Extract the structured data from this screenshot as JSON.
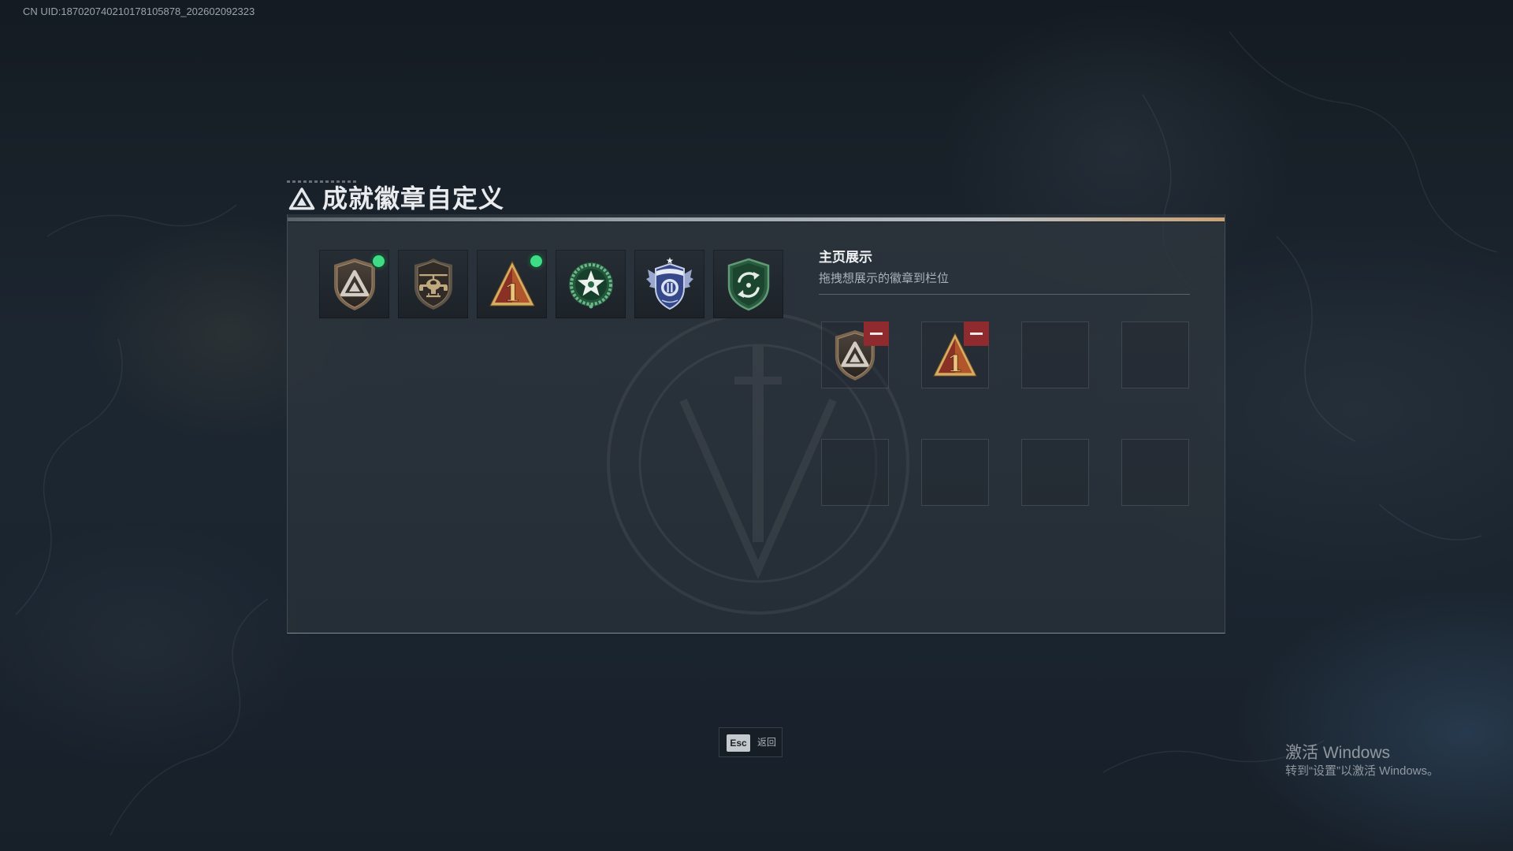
{
  "uid": "CN UID:187020740210178105878_202602092323",
  "title": "成就徽章自定义",
  "colors": {
    "new_dot": "#3fdc86",
    "remove_button": "#8f2b2f",
    "panel_accent": "#c9a276"
  },
  "badges": [
    {
      "icon": "shield-triangle-badge",
      "new_dot": true
    },
    {
      "icon": "helicopter-shield-badge",
      "new_dot": false
    },
    {
      "icon": "rank-one-triangle-badge",
      "new_dot": true,
      "emblem_text": "1"
    },
    {
      "icon": "green-star-wreath-badge",
      "new_dot": false
    },
    {
      "icon": "blue-winged-shield-badge",
      "new_dot": false
    },
    {
      "icon": "green-arrows-shield-badge",
      "new_dot": false
    }
  ],
  "showcase": {
    "title": "主页展示",
    "subtitle": "拖拽想展示的徽章到栏位",
    "slots": [
      {
        "icon": "shield-triangle-badge",
        "removable": true
      },
      {
        "icon": "rank-one-triangle-badge",
        "removable": true,
        "emblem_text": "1"
      },
      {
        "icon": null,
        "removable": false
      },
      {
        "icon": null,
        "removable": false
      },
      {
        "icon": null,
        "removable": false
      },
      {
        "icon": null,
        "removable": false
      },
      {
        "icon": null,
        "removable": false
      },
      {
        "icon": null,
        "removable": false
      }
    ]
  },
  "footer": {
    "key": "Esc",
    "label": "返回"
  },
  "watermark": {
    "line1": "激活 Windows",
    "line2": "转到“设置”以激活 Windows。"
  }
}
